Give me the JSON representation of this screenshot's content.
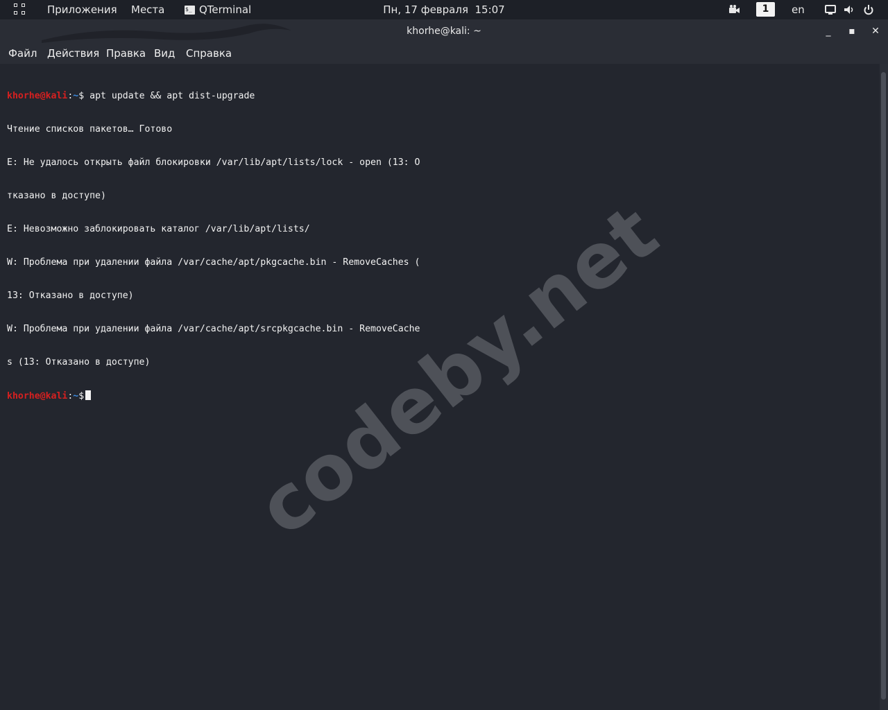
{
  "top_panel": {
    "apps_label": "Приложения",
    "places_label": "Места",
    "active_app_label": "QTerminal",
    "active_app_icon_glyph": "$_",
    "clock": "Пн, 17 февраля  15:07",
    "workspace": "1",
    "keyboard_layout": "en",
    "icons": [
      "grid-icon",
      "camera-icon",
      "screen-icon",
      "volume-icon",
      "power-icon"
    ]
  },
  "window": {
    "title": "khorhe@kali: ~",
    "controls": {
      "minimize": "_",
      "maximize": "▪",
      "close": "✕"
    }
  },
  "menubar": {
    "items": [
      "Файл",
      "Действия",
      "Правка",
      "Вид",
      "Справка"
    ]
  },
  "terminal": {
    "prompt": {
      "user_host": "khorhe@kali",
      "colon": ":",
      "path": "~",
      "dollar": "$"
    },
    "command": " apt update && apt dist-upgrade",
    "output": [
      "Чтение списков пакетов… Готово",
      "E: Не удалось открыть файл блокировки /var/lib/apt/lists/lock - open (13: О",
      "тказано в доступе)",
      "E: Невозможно заблокировать каталог /var/lib/apt/lists/",
      "W: Проблема при удалении файла /var/cache/apt/pkgcache.bin - RemoveCaches (",
      "13: Отказано в доступе)",
      "W: Проблема при удалении файла /var/cache/apt/srcpkgcache.bin - RemoveCache",
      "s (13: Отказано в доступе)"
    ]
  },
  "watermark": "codeby.net",
  "colors": {
    "panel_bg": "#1d2027",
    "window_bg": "#2a2d35",
    "terminal_bg": "#23262e",
    "prompt_user": "#d62020",
    "prompt_path": "#3b8be0",
    "text": "#f2f2f2"
  }
}
